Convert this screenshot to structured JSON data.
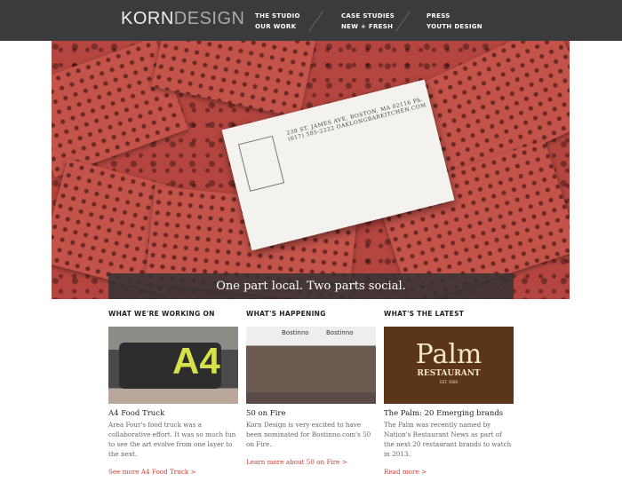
{
  "header": {
    "logo_bold": "KORN",
    "logo_light": "DESIGN",
    "nav": [
      [
        "THE STUDIO",
        "OUR WORK"
      ],
      [
        "CASE STUDIES",
        "NEW + FRESH"
      ],
      [
        "PRESS",
        "YOUTH DESIGN"
      ]
    ]
  },
  "hero": {
    "caption": "One part local. Two parts social.",
    "card_text": "238 ST. JAMES AVE, BOSTON, MA 02116  Ph. (617) 585-2222  OAKLONGBARKITCHEN.COM"
  },
  "columns": [
    {
      "heading": "WHAT WE'RE WORKING ON",
      "title": "A4 Food Truck",
      "body": "Area Four's food truck was a collaborative effort. It was so much fun to see the art evolve from one layer to the next.",
      "link": "See more A4 Food Truck  >",
      "image_text": "A4"
    },
    {
      "heading": "WHAT'S HAPPENING",
      "title": "50 on Fire",
      "body": "Korn Design is very excited to have been nominated for Bostinno.com's 50 on Fire.",
      "link": "Learn more about 50 on Fire  >",
      "image_text": "Bostinno"
    },
    {
      "heading": "WHAT'S THE LATEST",
      "title": "The Palm: 20 Emerging brands",
      "body": "The Palm was recently named by Nation's Restaurant News as part of the next 20 restaurant brands to watch in 2013.",
      "link": "Read more  >",
      "image_text": "Palm",
      "image_sub": "RESTAURANT",
      "image_est": "EST. 1926"
    }
  ]
}
